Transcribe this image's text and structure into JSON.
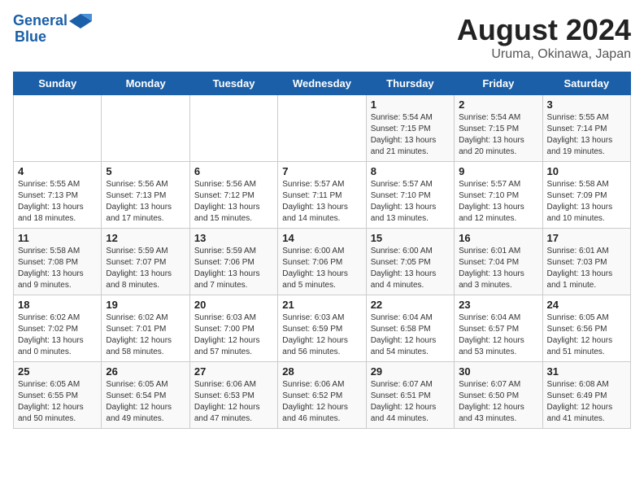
{
  "logo": {
    "line1": "General",
    "line2": "Blue"
  },
  "title": "August 2024",
  "subtitle": "Uruma, Okinawa, Japan",
  "weekdays": [
    "Sunday",
    "Monday",
    "Tuesday",
    "Wednesday",
    "Thursday",
    "Friday",
    "Saturday"
  ],
  "weeks": [
    [
      {
        "day": "",
        "info": ""
      },
      {
        "day": "",
        "info": ""
      },
      {
        "day": "",
        "info": ""
      },
      {
        "day": "",
        "info": ""
      },
      {
        "day": "1",
        "info": "Sunrise: 5:54 AM\nSunset: 7:15 PM\nDaylight: 13 hours\nand 21 minutes."
      },
      {
        "day": "2",
        "info": "Sunrise: 5:54 AM\nSunset: 7:15 PM\nDaylight: 13 hours\nand 20 minutes."
      },
      {
        "day": "3",
        "info": "Sunrise: 5:55 AM\nSunset: 7:14 PM\nDaylight: 13 hours\nand 19 minutes."
      }
    ],
    [
      {
        "day": "4",
        "info": "Sunrise: 5:55 AM\nSunset: 7:13 PM\nDaylight: 13 hours\nand 18 minutes."
      },
      {
        "day": "5",
        "info": "Sunrise: 5:56 AM\nSunset: 7:13 PM\nDaylight: 13 hours\nand 17 minutes."
      },
      {
        "day": "6",
        "info": "Sunrise: 5:56 AM\nSunset: 7:12 PM\nDaylight: 13 hours\nand 15 minutes."
      },
      {
        "day": "7",
        "info": "Sunrise: 5:57 AM\nSunset: 7:11 PM\nDaylight: 13 hours\nand 14 minutes."
      },
      {
        "day": "8",
        "info": "Sunrise: 5:57 AM\nSunset: 7:10 PM\nDaylight: 13 hours\nand 13 minutes."
      },
      {
        "day": "9",
        "info": "Sunrise: 5:57 AM\nSunset: 7:10 PM\nDaylight: 13 hours\nand 12 minutes."
      },
      {
        "day": "10",
        "info": "Sunrise: 5:58 AM\nSunset: 7:09 PM\nDaylight: 13 hours\nand 10 minutes."
      }
    ],
    [
      {
        "day": "11",
        "info": "Sunrise: 5:58 AM\nSunset: 7:08 PM\nDaylight: 13 hours\nand 9 minutes."
      },
      {
        "day": "12",
        "info": "Sunrise: 5:59 AM\nSunset: 7:07 PM\nDaylight: 13 hours\nand 8 minutes."
      },
      {
        "day": "13",
        "info": "Sunrise: 5:59 AM\nSunset: 7:06 PM\nDaylight: 13 hours\nand 7 minutes."
      },
      {
        "day": "14",
        "info": "Sunrise: 6:00 AM\nSunset: 7:06 PM\nDaylight: 13 hours\nand 5 minutes."
      },
      {
        "day": "15",
        "info": "Sunrise: 6:00 AM\nSunset: 7:05 PM\nDaylight: 13 hours\nand 4 minutes."
      },
      {
        "day": "16",
        "info": "Sunrise: 6:01 AM\nSunset: 7:04 PM\nDaylight: 13 hours\nand 3 minutes."
      },
      {
        "day": "17",
        "info": "Sunrise: 6:01 AM\nSunset: 7:03 PM\nDaylight: 13 hours\nand 1 minute."
      }
    ],
    [
      {
        "day": "18",
        "info": "Sunrise: 6:02 AM\nSunset: 7:02 PM\nDaylight: 13 hours\nand 0 minutes."
      },
      {
        "day": "19",
        "info": "Sunrise: 6:02 AM\nSunset: 7:01 PM\nDaylight: 12 hours\nand 58 minutes."
      },
      {
        "day": "20",
        "info": "Sunrise: 6:03 AM\nSunset: 7:00 PM\nDaylight: 12 hours\nand 57 minutes."
      },
      {
        "day": "21",
        "info": "Sunrise: 6:03 AM\nSunset: 6:59 PM\nDaylight: 12 hours\nand 56 minutes."
      },
      {
        "day": "22",
        "info": "Sunrise: 6:04 AM\nSunset: 6:58 PM\nDaylight: 12 hours\nand 54 minutes."
      },
      {
        "day": "23",
        "info": "Sunrise: 6:04 AM\nSunset: 6:57 PM\nDaylight: 12 hours\nand 53 minutes."
      },
      {
        "day": "24",
        "info": "Sunrise: 6:05 AM\nSunset: 6:56 PM\nDaylight: 12 hours\nand 51 minutes."
      }
    ],
    [
      {
        "day": "25",
        "info": "Sunrise: 6:05 AM\nSunset: 6:55 PM\nDaylight: 12 hours\nand 50 minutes."
      },
      {
        "day": "26",
        "info": "Sunrise: 6:05 AM\nSunset: 6:54 PM\nDaylight: 12 hours\nand 49 minutes."
      },
      {
        "day": "27",
        "info": "Sunrise: 6:06 AM\nSunset: 6:53 PM\nDaylight: 12 hours\nand 47 minutes."
      },
      {
        "day": "28",
        "info": "Sunrise: 6:06 AM\nSunset: 6:52 PM\nDaylight: 12 hours\nand 46 minutes."
      },
      {
        "day": "29",
        "info": "Sunrise: 6:07 AM\nSunset: 6:51 PM\nDaylight: 12 hours\nand 44 minutes."
      },
      {
        "day": "30",
        "info": "Sunrise: 6:07 AM\nSunset: 6:50 PM\nDaylight: 12 hours\nand 43 minutes."
      },
      {
        "day": "31",
        "info": "Sunrise: 6:08 AM\nSunset: 6:49 PM\nDaylight: 12 hours\nand 41 minutes."
      }
    ]
  ]
}
